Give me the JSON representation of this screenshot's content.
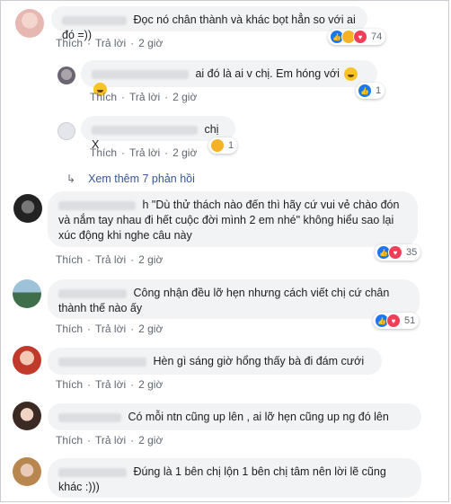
{
  "actions": {
    "like": "Thích",
    "reply": "Trả lời",
    "sep": "·"
  },
  "comments": [
    {
      "text": "Đọc nó chân thành và khác bọt hẳn so với ai đó =))",
      "time": "2 giờ",
      "reactions": {
        "icons": [
          "like",
          "haha",
          "love"
        ],
        "count": "74"
      }
    },
    {
      "text": "ai đó là ai v chị. Em hóng với",
      "time": "2 giờ",
      "reactions": {
        "icons": [
          "like"
        ],
        "count": "1"
      }
    },
    {
      "text": "chị X",
      "time": "2 giờ",
      "reactions": {
        "icons": [
          "haha"
        ],
        "count": "1"
      }
    },
    {
      "text": "h \"Dù thử thách nào đến thì hãy cứ vui vẻ chào đón và nắm tay nhau đi hết cuộc đời mình 2 em nhé\" không hiểu sao lại xúc động khi nghe câu này",
      "time": "2 giờ",
      "reactions": {
        "icons": [
          "like",
          "love"
        ],
        "count": "35"
      }
    },
    {
      "text": "Công nhận đều lỡ hẹn nhưng cách viết chị cứ chân thành thế nào ấy",
      "time": "2 giờ",
      "reactions": {
        "icons": [
          "like",
          "love"
        ],
        "count": "51"
      }
    },
    {
      "text": "Hèn gì sáng giờ hổng thấy bà đi đám cưới",
      "time": "2 giờ"
    },
    {
      "text": "Có mỗi ntn cũng up lên , ai lỡ hẹn cũng up ng đó lên",
      "time": "2 giờ"
    },
    {
      "text": "Đúng là 1 bên chị lộn 1 bên chị tâm nên lời lẽ cũng khác :)))"
    }
  ],
  "more_replies": "Xem thêm 7 phản hồi",
  "colors": {
    "like": "#1877f2",
    "love": "#f33e58",
    "haha": "#f7b125",
    "link": "#385898"
  }
}
